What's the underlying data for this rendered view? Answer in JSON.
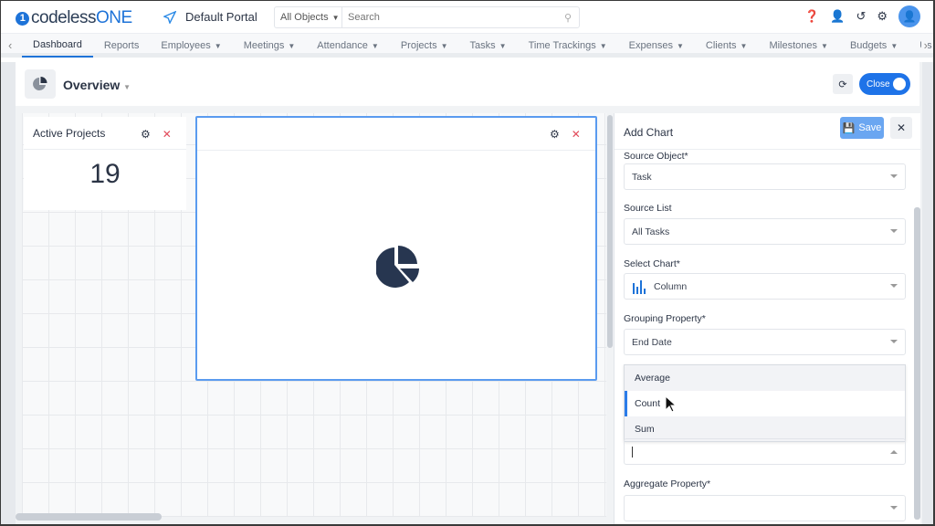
{
  "header": {
    "logo_text": "codelessONE",
    "logo_main": "codeless",
    "logo_accent": "ONE",
    "portal": "Default Portal",
    "search_scope": "All Objects",
    "search_placeholder": "Search"
  },
  "nav": {
    "items": [
      {
        "label": "Dashboard",
        "dropdown": false,
        "active": true
      },
      {
        "label": "Reports",
        "dropdown": false
      },
      {
        "label": "Employees",
        "dropdown": true
      },
      {
        "label": "Meetings",
        "dropdown": true
      },
      {
        "label": "Attendance",
        "dropdown": true
      },
      {
        "label": "Projects",
        "dropdown": true
      },
      {
        "label": "Tasks",
        "dropdown": true
      },
      {
        "label": "Time Trackings",
        "dropdown": true
      },
      {
        "label": "Expenses",
        "dropdown": true
      },
      {
        "label": "Clients",
        "dropdown": true
      },
      {
        "label": "Milestones",
        "dropdown": true
      },
      {
        "label": "Budgets",
        "dropdown": true
      },
      {
        "label": "Us",
        "dropdown": false
      }
    ]
  },
  "dashboard": {
    "title": "Overview",
    "toggle_label": "Close",
    "widgets": [
      {
        "title": "Active Projects",
        "value": "19"
      },
      {
        "title": ""
      }
    ]
  },
  "panel": {
    "title": "Add Chart",
    "save_label": "Save",
    "fields": {
      "source_object": {
        "label": "Source Object*",
        "value": "Task"
      },
      "source_list": {
        "label": "Source List",
        "value": "All Tasks"
      },
      "select_chart": {
        "label": "Select Chart*",
        "value": "Column"
      },
      "grouping_property": {
        "label": "Grouping Property*",
        "value": "End Date"
      },
      "aggregate_function": {
        "value": "",
        "options": [
          "Average",
          "Count",
          "Sum"
        ],
        "highlighted": "Count"
      },
      "aggregate_property": {
        "label": "Aggregate Property*",
        "value": ""
      }
    }
  },
  "colors": {
    "accent": "#1e73e8",
    "close_red": "#e24b5b",
    "save_button": "#6aa6f1"
  }
}
